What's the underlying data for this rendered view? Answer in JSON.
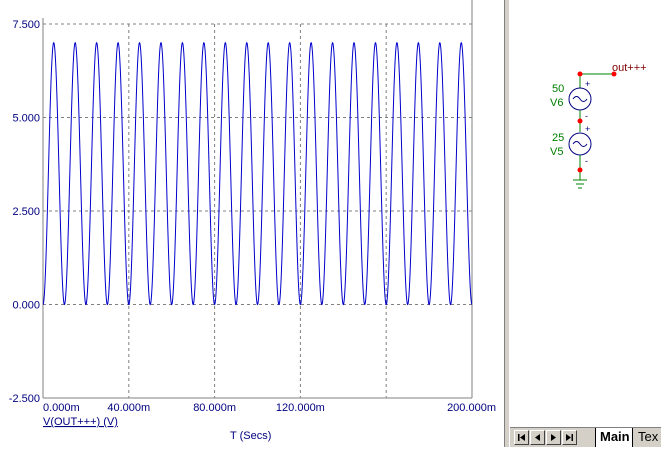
{
  "chart_data": {
    "type": "line",
    "title": "",
    "xlabel": "T (Secs)",
    "ylabel": "",
    "xlim": [
      0,
      0.2
    ],
    "ylim": [
      -2.5,
      7.5
    ],
    "x_ticks": [
      "0.000m",
      "40.000m",
      "80.000m",
      "120.000m",
      "200.000m"
    ],
    "y_ticks": [
      "7.500",
      "5.000",
      "2.500",
      "0.000",
      "-2.500"
    ],
    "grid": true,
    "legend_position": "bottom-left",
    "series": [
      {
        "name": "V(OUT+++) (V)",
        "color": "#0000cc",
        "function": "3.5 + 3.5*sin(2*pi*100*t - pi/2)",
        "offset": 3.5,
        "amplitude": 3.5,
        "frequency_hz": 100,
        "x_range": [
          0,
          0.2
        ]
      }
    ]
  },
  "schematic": {
    "components": [
      {
        "value": "50",
        "name": "V6"
      },
      {
        "value": "25",
        "name": "V5"
      }
    ],
    "net_label": "out+++",
    "plus": "+",
    "minus": "-"
  },
  "tabs": {
    "main": "Main",
    "text": "Tex"
  },
  "colors": {
    "trace": "#0000cc",
    "grid": "#808080",
    "axis_text": "#000080",
    "component_text": "#008000",
    "net_label": "#800000",
    "node": "#ff0000"
  },
  "icons": [
    "first-page-icon",
    "prev-page-icon",
    "next-page-icon",
    "last-page-icon"
  ]
}
